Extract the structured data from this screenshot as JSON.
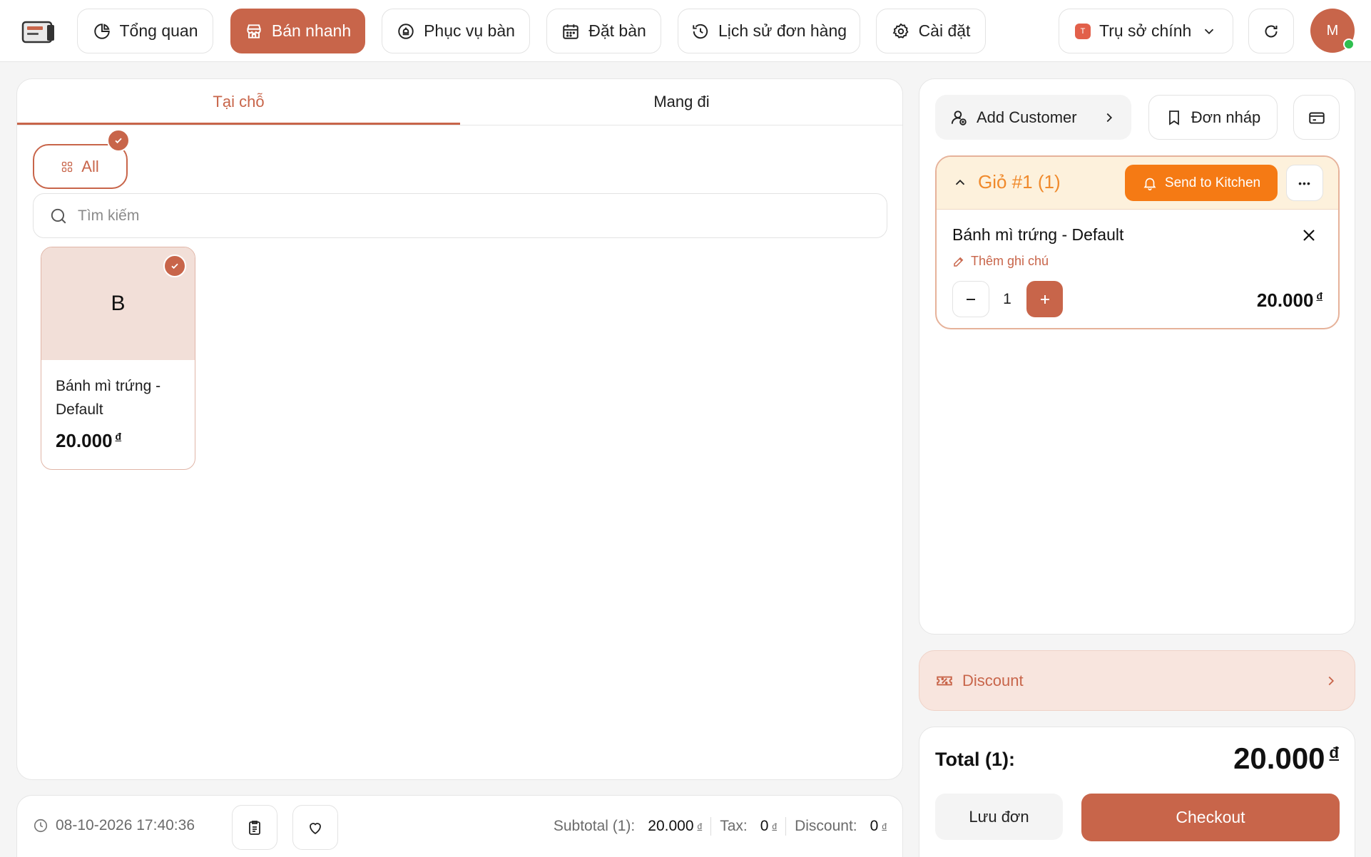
{
  "header": {
    "logo_icon": "pos-terminal-icon",
    "nav": [
      {
        "label": "Tổng quan",
        "icon": "pie-chart-icon",
        "active": false
      },
      {
        "label": "Bán nhanh",
        "icon": "store-icon",
        "active": true
      },
      {
        "label": "Phục vụ bàn",
        "icon": "table-service-icon",
        "active": false
      },
      {
        "label": "Đặt bàn",
        "icon": "calendar-icon",
        "active": false
      },
      {
        "label": "Lịch sử đơn hàng",
        "icon": "history-icon",
        "active": false
      },
      {
        "label": "Cài đặt",
        "icon": "gear-icon",
        "active": false
      }
    ],
    "branch": {
      "badge": "T",
      "label": "Trụ sở chính"
    },
    "avatar": {
      "initial": "M",
      "status": "online"
    }
  },
  "order_panel": {
    "tabs": [
      {
        "label": "Tại chỗ",
        "active": true
      },
      {
        "label": "Mang đi",
        "active": false
      }
    ],
    "category_all": "All",
    "search": {
      "placeholder": "Tìm kiếm",
      "value": ""
    },
    "products": [
      {
        "initial": "B",
        "name": "Bánh mì trứng - Default",
        "price": "20.000",
        "currency": "đ",
        "selected": true
      }
    ]
  },
  "footer": {
    "datetime": "08-10-2026 17:40:36",
    "subtotal_label": "Subtotal (1):",
    "subtotal_value": "20.000",
    "tax_label": "Tax:",
    "tax_value": "0",
    "discount_label": "Discount:",
    "discount_value": "0",
    "currency": "đ"
  },
  "cart_panel": {
    "add_customer": "Add Customer",
    "draft": "Đơn nháp",
    "cart": {
      "title": "Giỏ #1 (1)",
      "send_to_kitchen": "Send to Kitchen",
      "more": "•••",
      "item": {
        "name": "Bánh mì trứng - Default",
        "note_link": "Thêm ghi chú",
        "quantity": "1",
        "price": "20.000",
        "currency": "đ"
      }
    },
    "discount": "Discount",
    "total_label": "Total (1):",
    "total_value": "20.000",
    "currency": "đ",
    "save_order": "Lưu đơn",
    "checkout": "Checkout"
  },
  "colors": {
    "primary": "#c8654a",
    "accent_orange": "#f57a14",
    "cart_header_bg": "#fdf1dc",
    "discount_bg": "#f8e5de"
  }
}
